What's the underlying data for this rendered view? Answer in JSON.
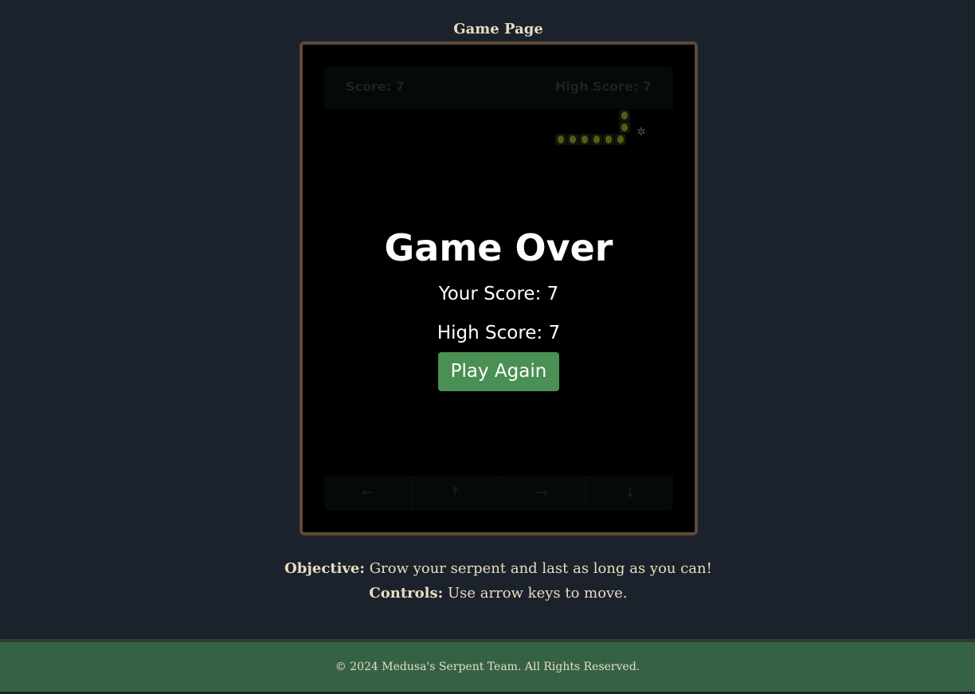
{
  "page": {
    "title": "Game Page"
  },
  "game": {
    "score_label": "Score: 7",
    "high_score_label": "High Score: 7",
    "controls": {
      "left": "←",
      "up": "↑",
      "right": "→",
      "down": "↓"
    },
    "game_over": {
      "title": "Game Over",
      "your_score": "Your Score: 7",
      "high_score": "High Score: 7",
      "play_again": "Play Again"
    }
  },
  "info": {
    "objective_label": "Objective:",
    "objective_text": " Grow your serpent and last as long as you can!",
    "controls_label": "Controls:",
    "controls_text": " Use arrow keys to move."
  },
  "footer": {
    "copyright": "© 2024 Medusa's Serpent Team. All Rights Reserved."
  },
  "colors": {
    "background": "#1b222c",
    "frame_border": "#5e4a3a",
    "play_button": "#4a8f53",
    "footer": "#356244",
    "text": "#e8dcc0"
  },
  "icons": {
    "snake_head": "medusa-head-icon"
  }
}
